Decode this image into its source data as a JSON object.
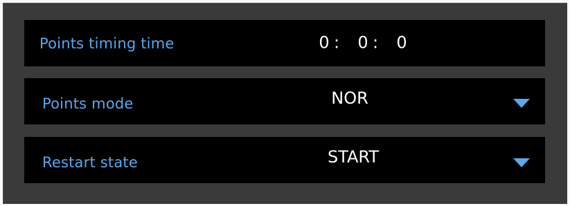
{
  "points_timing": {
    "label": "Points timing time",
    "hours": "0",
    "minutes": "0",
    "seconds": "0",
    "separator": ":"
  },
  "points_mode": {
    "label": "Points mode",
    "value": "NOR",
    "icon": "triangle-down-icon"
  },
  "restart_state": {
    "label": "Restart state",
    "value": "START",
    "icon": "triangle-down-icon"
  },
  "colors": {
    "label": "#5aa8ee",
    "value": "#ffffff",
    "row_bg": "#000000",
    "panel_bg": "#3a3a3a",
    "accent": "#5aa8ee"
  }
}
